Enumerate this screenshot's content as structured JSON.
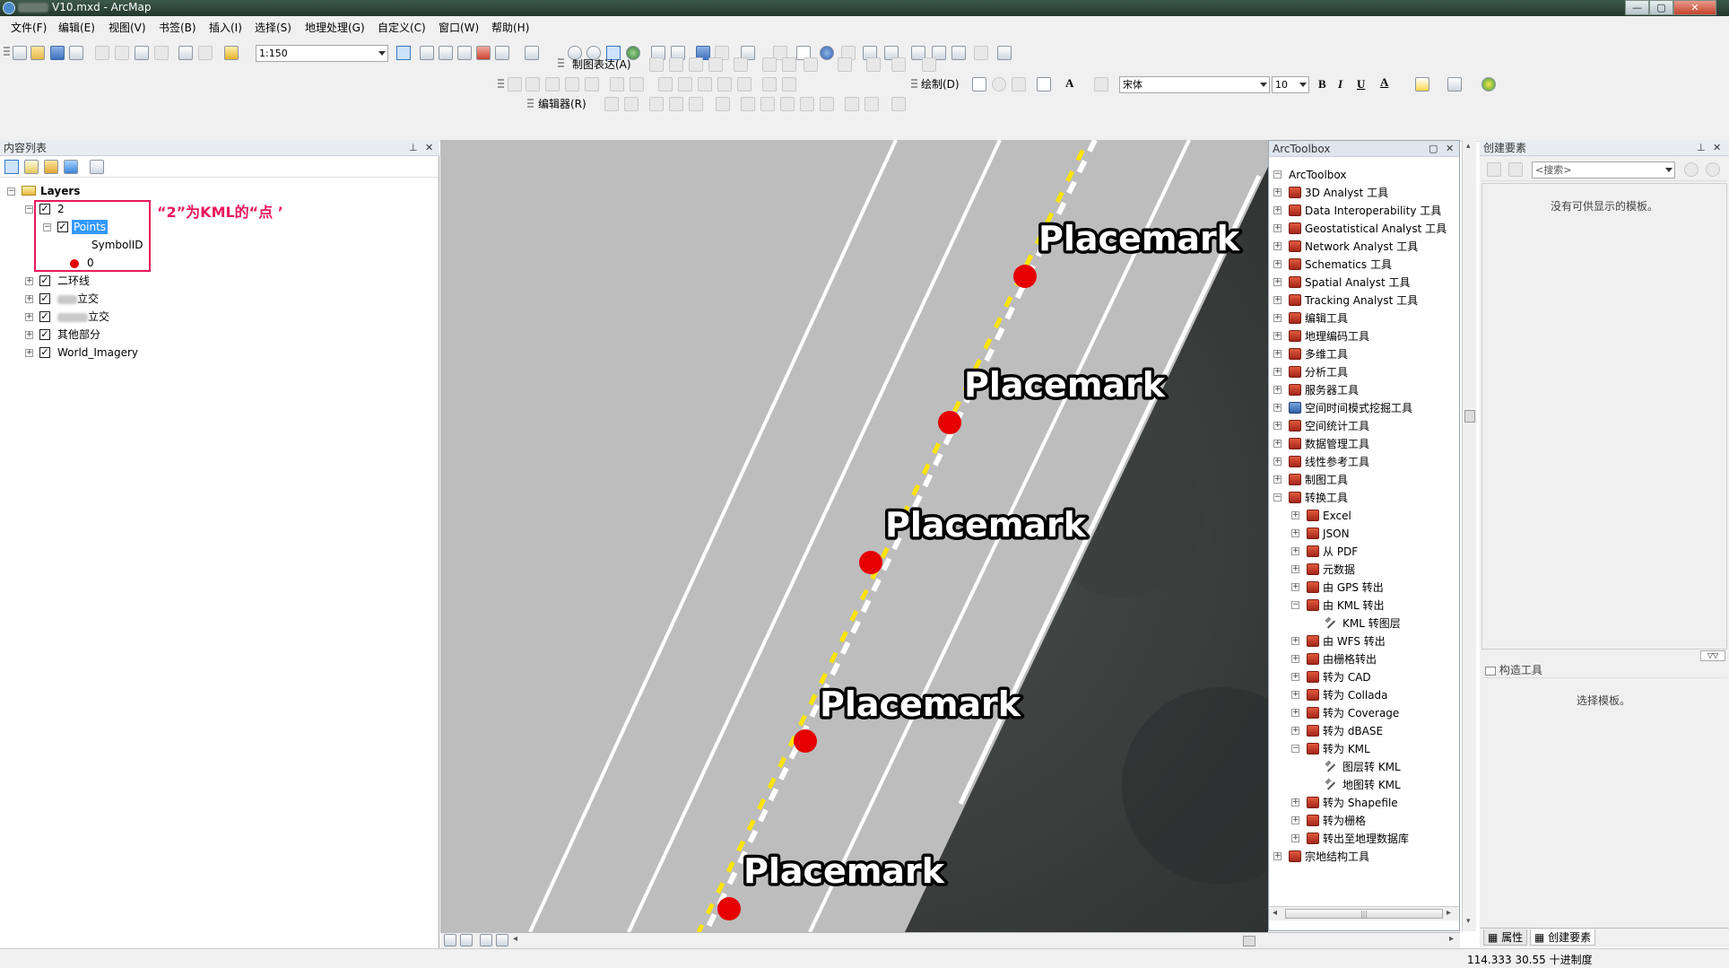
{
  "window": {
    "title": "V10.mxd - ArcMap",
    "min": "—",
    "max": "▢",
    "close": "✕"
  },
  "menu": [
    "文件(F)",
    "编辑(E)",
    "视图(V)",
    "书签(B)",
    "插入(I)",
    "选择(S)",
    "地理处理(G)",
    "自定义(C)",
    "窗口(W)",
    "帮助(H)"
  ],
  "toolbar": {
    "scale": "1:150",
    "cartographic_label": "制图表达(A)",
    "draw_label": "绘制(D)",
    "font_name": "宋体",
    "font_size": "10",
    "bold": "B",
    "italic": "I",
    "underline": "U",
    "editor_label": "编辑器(R)"
  },
  "toc": {
    "title": "内容列表",
    "root": "Layers",
    "layers": [
      {
        "name": "2",
        "checked": true,
        "expanded": true
      },
      {
        "name": "Points",
        "checked": true,
        "expanded": true,
        "selected": true
      },
      {
        "name": "SymbolID"
      },
      {
        "name": "0"
      },
      {
        "name": "二环线",
        "checked": true
      },
      {
        "name": "立交",
        "checked": true
      },
      {
        "name": "立交",
        "checked": true
      },
      {
        "name": "其他部分",
        "checked": true
      },
      {
        "name": "World_Imagery",
        "checked": true
      }
    ],
    "annotation": "“2”为KML的“点 ’"
  },
  "map": {
    "placemarks": [
      "Placemark",
      "Placemark",
      "Placemark",
      "Placemark",
      "Placemark"
    ],
    "point_color": "#e60000"
  },
  "arctoolbox": {
    "title": "ArcToolbox",
    "root": "ArcToolbox",
    "items": [
      {
        "label": "3D Analyst 工具",
        "level": 0
      },
      {
        "label": "Data Interoperability 工具",
        "level": 0
      },
      {
        "label": "Geostatistical Analyst 工具",
        "level": 0
      },
      {
        "label": "Network Analyst 工具",
        "level": 0
      },
      {
        "label": "Schematics 工具",
        "level": 0
      },
      {
        "label": "Spatial Analyst 工具",
        "level": 0
      },
      {
        "label": "Tracking Analyst 工具",
        "level": 0
      },
      {
        "label": "编辑工具",
        "level": 0
      },
      {
        "label": "地理编码工具",
        "level": 0
      },
      {
        "label": "多维工具",
        "level": 0
      },
      {
        "label": "分析工具",
        "level": 0
      },
      {
        "label": "服务器工具",
        "level": 0
      },
      {
        "label": "空间时间模式挖掘工具",
        "level": 0
      },
      {
        "label": "空间统计工具",
        "level": 0
      },
      {
        "label": "数据管理工具",
        "level": 0
      },
      {
        "label": "线性参考工具",
        "level": 0
      },
      {
        "label": "制图工具",
        "level": 0
      },
      {
        "label": "转换工具",
        "level": 0,
        "expanded": true
      },
      {
        "label": "Excel",
        "level": 1
      },
      {
        "label": "JSON",
        "level": 1
      },
      {
        "label": "从 PDF",
        "level": 1
      },
      {
        "label": "元数据",
        "level": 1
      },
      {
        "label": "由 GPS 转出",
        "level": 1
      },
      {
        "label": "由 KML 转出",
        "level": 1,
        "expanded": true
      },
      {
        "label": "KML 转图层",
        "level": 2
      },
      {
        "label": "由 WFS 转出",
        "level": 1
      },
      {
        "label": "由栅格转出",
        "level": 1
      },
      {
        "label": "转为 CAD",
        "level": 1
      },
      {
        "label": "转为 Collada",
        "level": 1
      },
      {
        "label": "转为 Coverage",
        "level": 1
      },
      {
        "label": "转为 dBASE",
        "level": 1
      },
      {
        "label": "转为 KML",
        "level": 1,
        "expanded": true
      },
      {
        "label": "图层转 KML",
        "level": 2
      },
      {
        "label": "地图转 KML",
        "level": 2
      },
      {
        "label": "转为 Shapefile",
        "level": 1
      },
      {
        "label": "转为栅格",
        "level": 1
      },
      {
        "label": "转出至地理数据库",
        "level": 1
      },
      {
        "label": "宗地结构工具",
        "level": 0
      }
    ]
  },
  "create_features": {
    "title": "创建要素",
    "search_placeholder": "<搜索>",
    "empty_msg": "没有可供显示的模板。",
    "construct_title": "构造工具",
    "construct_msg": "选择模板。",
    "tab_properties": "属性",
    "tab_create": "创建要素"
  },
  "status": {
    "coords": "114.333  30.55 十进制度"
  }
}
